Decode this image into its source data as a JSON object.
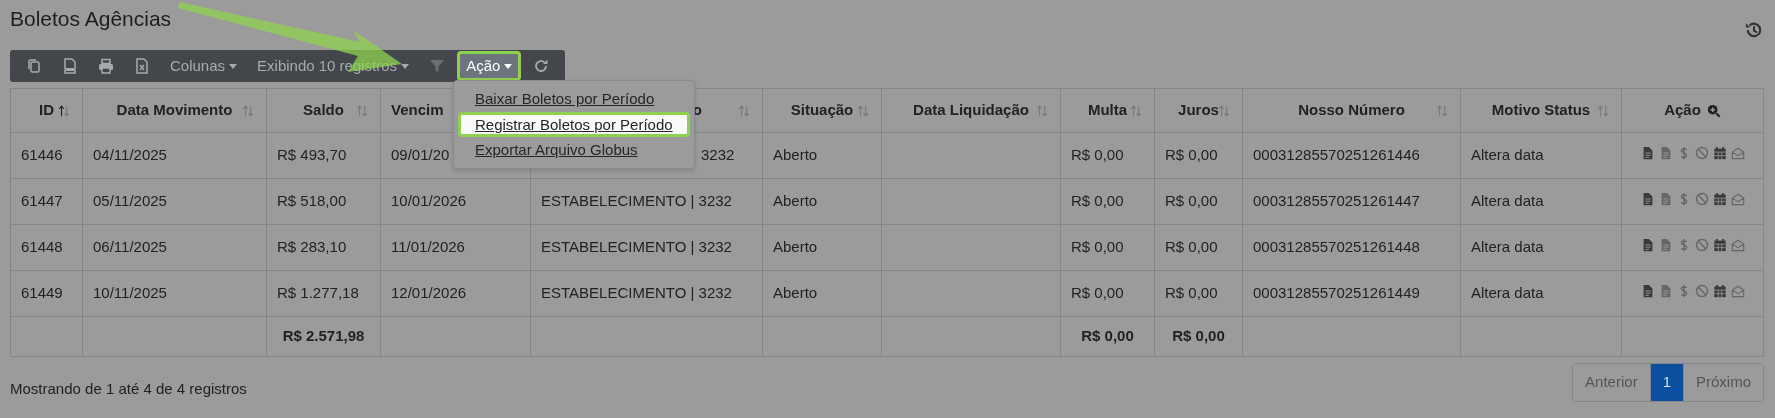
{
  "page": {
    "title": "Boletos Agências"
  },
  "toolbar": {
    "columns_dropdown": "Colunas",
    "page_size_dropdown": "Exibindo 10 registros",
    "action_dropdown": {
      "label": "Ação",
      "highlighted": true,
      "expanded": true,
      "items": [
        {
          "label": "Baixar Boletos por Período",
          "highlighted": false
        },
        {
          "label": "Registrar Boletos por Período",
          "highlighted": true
        },
        {
          "label": "Exportar Arquivo Globus",
          "highlighted": false
        }
      ]
    }
  },
  "table": {
    "columns": [
      {
        "label": "ID",
        "kind": "sortable",
        "sorted": true
      },
      {
        "label": "Data Movimento",
        "kind": "sortable",
        "sorted": false
      },
      {
        "label": "Saldo",
        "kind": "sortable",
        "sorted": false
      },
      {
        "label": "Vencim",
        "kind": "plain"
      },
      {
        "label": "o",
        "kind": "sortable",
        "sorted": false
      },
      {
        "label": "Situação",
        "kind": "sortable",
        "sorted": false
      },
      {
        "label": "Data Liquidação",
        "kind": "sortable",
        "sorted": false
      },
      {
        "label": "Multa",
        "kind": "sortable",
        "sorted": false
      },
      {
        "label": "Juros",
        "kind": "sortable",
        "sorted": false
      },
      {
        "label": "Nosso Número",
        "kind": "sortable",
        "sorted": false
      },
      {
        "label": "Motivo Status",
        "kind": "sortable",
        "sorted": false
      },
      {
        "label": "Ação",
        "kind": "action"
      }
    ],
    "rows": [
      {
        "cells": [
          "61446",
          "04/11/2025",
          "R$ 493,70",
          "09/01/20",
          "3232",
          "Aberto",
          "",
          "R$ 0,00",
          "R$ 0,00",
          "00031285570251261446",
          "Altera data"
        ]
      },
      {
        "cells": [
          "61447",
          "05/11/2025",
          "R$ 518,00",
          "10/01/2026",
          "ESTABELECIMENTO | 3232",
          "Aberto",
          "",
          "R$ 0,00",
          "R$ 0,00",
          "00031285570251261447",
          "Altera data"
        ]
      },
      {
        "cells": [
          "61448",
          "06/11/2025",
          "R$ 283,10",
          "11/01/2026",
          "ESTABELECIMENTO | 3232",
          "Aberto",
          "",
          "R$ 0,00",
          "R$ 0,00",
          "00031285570251261448",
          "Altera data"
        ]
      },
      {
        "cells": [
          "61449",
          "10/11/2025",
          "R$ 1.277,18",
          "12/01/2026",
          "ESTABELECIMENTO | 3232",
          "Aberto",
          "",
          "R$ 0,00",
          "R$ 0,00",
          "00031285570251261449",
          "Altera data"
        ]
      }
    ],
    "totals": {
      "saldo": "R$ 2.571,98",
      "multa": "R$ 0,00",
      "juros": "R$ 0,00"
    }
  },
  "footer": {
    "info": "Mostrando de 1 até 4 de 4 registros",
    "pagination": [
      {
        "label": "Anterior",
        "selected": false
      },
      {
        "label": "1",
        "selected": true
      },
      {
        "label": "Próximo",
        "selected": false
      }
    ]
  }
}
